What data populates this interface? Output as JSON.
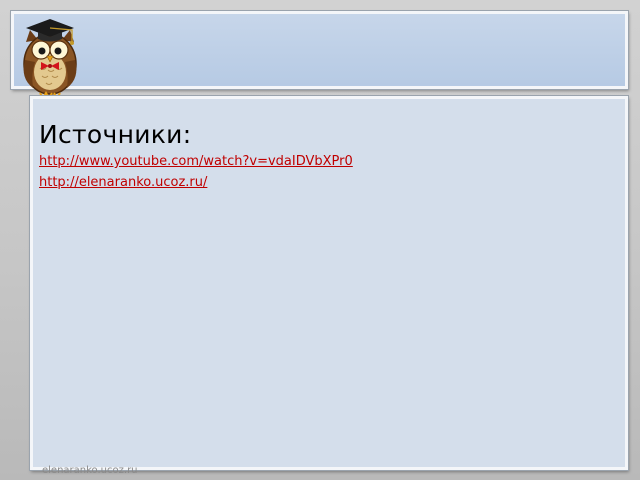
{
  "header": {
    "logo_icon": "owl-graduate-icon"
  },
  "content": {
    "heading": "Источники:",
    "links": [
      {
        "text": "http://www.youtube.com/watch?v=vdaIDVbXPr0"
      },
      {
        "text": "http://elenaranko.ucoz.ru/"
      }
    ]
  },
  "footer": {
    "watermark": "elenaranko.ucoz.ru"
  },
  "colors": {
    "link": "#c00000",
    "header_panel": "#bccee6",
    "content_panel": "#d4deeb"
  }
}
